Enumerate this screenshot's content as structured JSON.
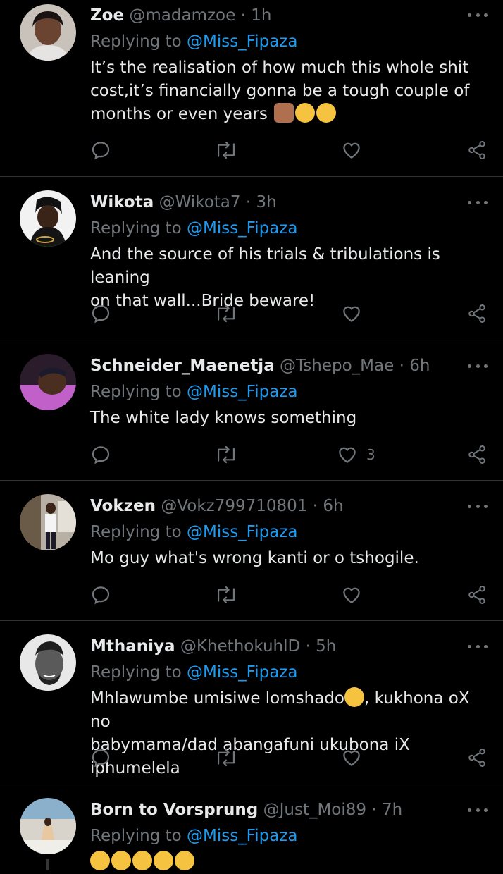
{
  "reply_prefix": "Replying to",
  "tweets": [
    {
      "name": "Zoe",
      "handle": "@madamzoe",
      "dot": "·",
      "time": "1h",
      "reply_to": "@Miss_Fipaza",
      "text_lines": [
        "It’s the realisation of how much this whole shit",
        "cost,it’s financially gonna be a tough couple of",
        "months or even years"
      ],
      "emojis": [
        "person-facepalming",
        "face-with-tears-of-joy",
        "face-with-tears-of-joy"
      ],
      "likes": ""
    },
    {
      "name": "Wikota",
      "handle": "@Wikota7",
      "dot": "·",
      "time": "3h",
      "reply_to": "@Miss_Fipaza",
      "text_lines": [
        "And the source of his trials & tribulations is leaning",
        "on that wall...Bride beware!"
      ],
      "likes": ""
    },
    {
      "name": "Schneider_Maenetja",
      "handle": "@Tshepo_Mae",
      "dot": "·",
      "time": "6h",
      "reply_to": "@Miss_Fipaza",
      "text_lines": [
        "The white lady knows something"
      ],
      "likes": "3"
    },
    {
      "name": "Vokzen",
      "handle": "@Vokz799710801",
      "dot": "·",
      "time": "6h",
      "reply_to": "@Miss_Fipaza",
      "text_lines": [
        "Mo guy what's wrong kanti or o tshogile."
      ],
      "likes": ""
    },
    {
      "name": "Mthaniya",
      "handle": "@KhethokuhlD",
      "dot": "·",
      "time": "5h",
      "reply_to": "@Miss_Fipaza",
      "text_lines": [
        "Mhlawumbe umisiwe lomshado",
        ", kukhona oX no",
        "babymama/dad abangafuni ukubona iX iphumelela"
      ],
      "emojis": [
        "pensive-face"
      ],
      "likes": ""
    },
    {
      "name": "Born to Vorsprung",
      "handle": "@Just_Moi89",
      "dot": "·",
      "time": "7h",
      "reply_to": "@Miss_Fipaza",
      "emojis": [
        "rolling-on-floor-laughing",
        "rolling-on-floor-laughing",
        "rolling-on-floor-laughing",
        "rolling-on-floor-laughing",
        "rolling-on-floor-laughing"
      ],
      "likes": ""
    }
  ],
  "colors": {
    "background": "#000000",
    "name": "#e7e9ea",
    "muted": "#71767b",
    "mention": "#1d9bf0",
    "divider": "#2f3336"
  }
}
